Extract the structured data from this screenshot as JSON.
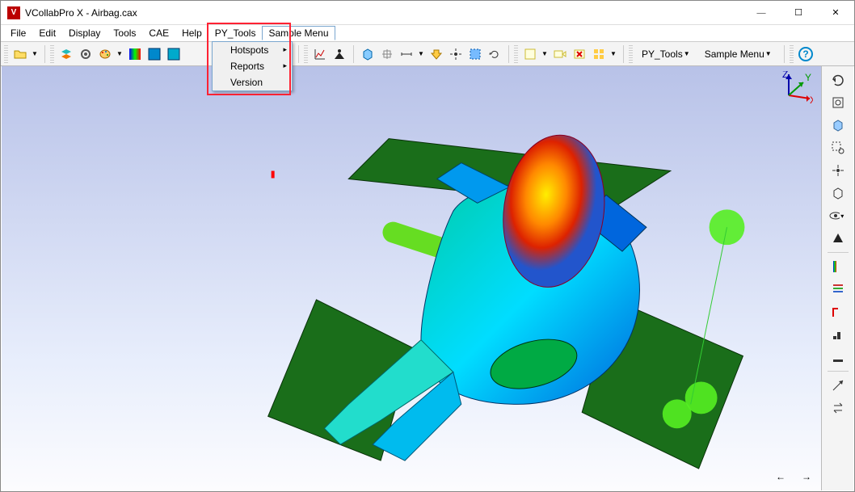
{
  "window": {
    "title": "VCollabPro X - Airbag.cax",
    "logo_letter": "V",
    "btn_min": "—",
    "btn_max": "☐",
    "btn_close": "✕"
  },
  "menubar": {
    "items": [
      "File",
      "Edit",
      "Display",
      "Tools",
      "CAE",
      "Help",
      "PY_Tools",
      "Sample Menu"
    ],
    "open_index": 7
  },
  "sample_menu": {
    "items": [
      {
        "label": "Hotspots",
        "has_sub": true
      },
      {
        "label": "Reports",
        "has_sub": true
      },
      {
        "label": "Version",
        "has_sub": false
      }
    ]
  },
  "toolbar_right_text": {
    "py_tools": "PY_Tools",
    "sample_menu": "Sample Menu"
  },
  "axis": {
    "x": "X",
    "y": "Y",
    "z": "Z"
  },
  "nav": {
    "prev": "←",
    "next": "→"
  }
}
